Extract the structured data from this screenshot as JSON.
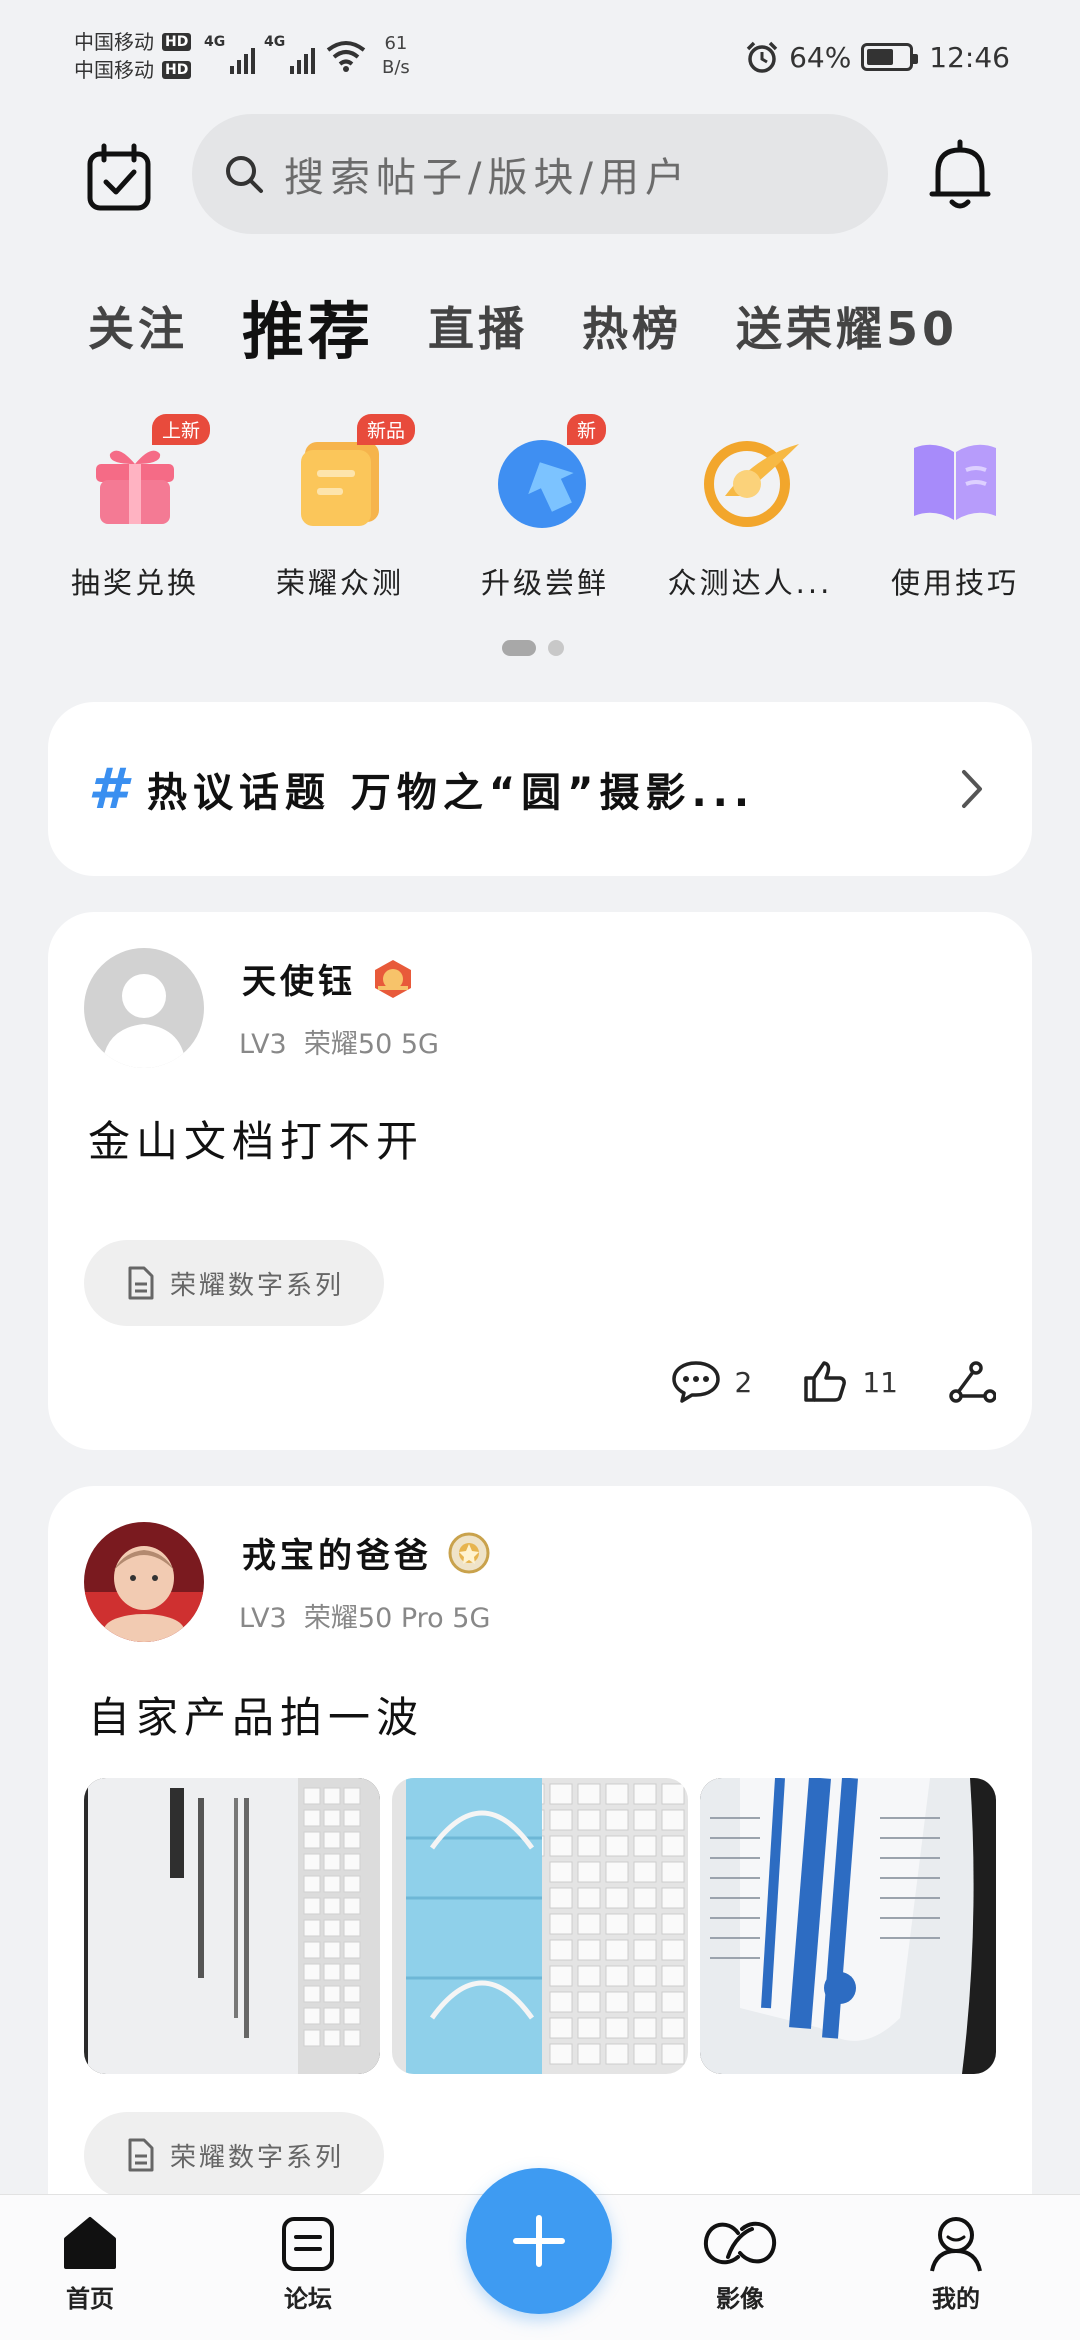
{
  "status_bar": {
    "carrier_1": "中国移动",
    "carrier_2": "中国移动",
    "hd": "HD",
    "network": "4G",
    "speed_value": "61",
    "speed_unit": "B/s",
    "battery": "64%",
    "battery_level": 0.64,
    "time": "12:46"
  },
  "header": {
    "search_placeholder": "搜索帖子/版块/用户"
  },
  "tabs": [
    {
      "label": "关注",
      "active": false
    },
    {
      "label": "推荐",
      "active": true
    },
    {
      "label": "直播",
      "active": false
    },
    {
      "label": "热榜",
      "active": false
    },
    {
      "label": "送荣耀50",
      "active": false
    }
  ],
  "quick_items": [
    {
      "label": "抽奖兑换",
      "badge": "上新",
      "icon": "gift-icon"
    },
    {
      "label": "荣耀众测",
      "badge": "新品",
      "icon": "notepad-icon"
    },
    {
      "label": "升级尝鲜",
      "badge": "新",
      "icon": "upgrade-icon"
    },
    {
      "label": "众测达人...",
      "badge": "",
      "icon": "tester-icon"
    },
    {
      "label": "使用技巧",
      "badge": "",
      "icon": "book-icon"
    }
  ],
  "topic": {
    "hash": "#",
    "text": "热议话题  万物之“圆”摄影..."
  },
  "posts": [
    {
      "username": "天使钰",
      "level": "LV3",
      "device": "荣耀50 5G",
      "title": "金山文档打不开",
      "tag": "荣耀数字系列",
      "comments": "2",
      "likes": "11"
    },
    {
      "username": "戎宝的爸爸",
      "level": "LV3",
      "device": "荣耀50 Pro 5G",
      "title": "自家产品拍一波",
      "tag": "荣耀数字系列"
    }
  ],
  "bottom_nav": [
    {
      "label": "首页",
      "icon": "home-icon"
    },
    {
      "label": "论坛",
      "icon": "forum-icon"
    },
    {
      "label": "影像",
      "icon": "imaging-icon"
    },
    {
      "label": "我的",
      "icon": "profile-icon"
    }
  ]
}
